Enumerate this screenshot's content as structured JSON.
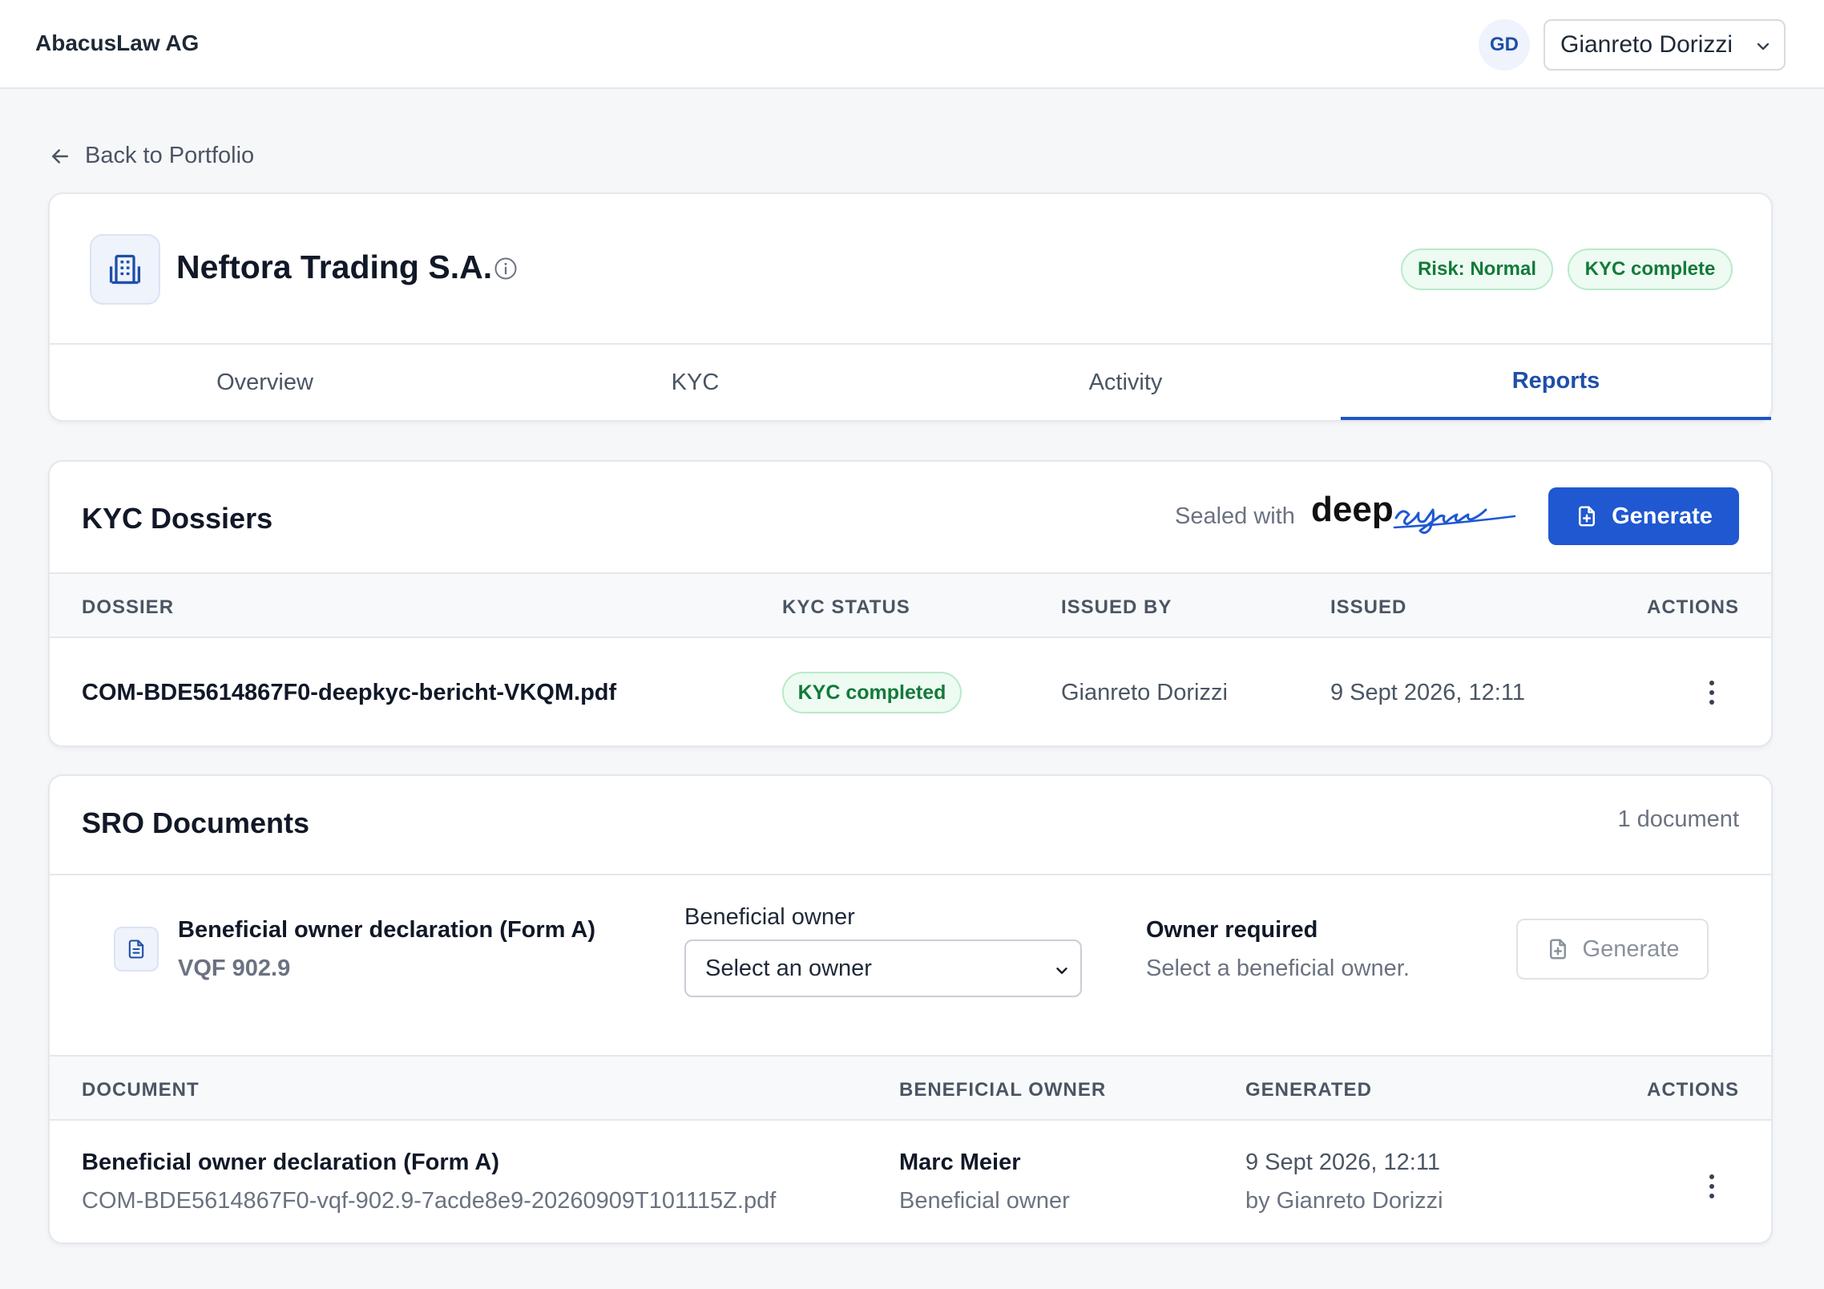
{
  "topbar": {
    "app_name": "AbacusLaw AG",
    "avatar_initials": "GD",
    "user_name": "Gianreto Dorizzi"
  },
  "back_link": "Back to Portfolio",
  "company": {
    "name": "Neftora Trading S.A.",
    "badges": [
      "Risk: Normal",
      "KYC complete"
    ]
  },
  "tabs": [
    {
      "label": "Overview",
      "active": false
    },
    {
      "label": "KYC",
      "active": false
    },
    {
      "label": "Activity",
      "active": false
    },
    {
      "label": "Reports",
      "active": true
    }
  ],
  "kyc_dossiers": {
    "title": "KYC Dossiers",
    "sealed_with": "Sealed with",
    "logo_text": "deepsign",
    "generate_label": "Generate",
    "columns": [
      "DOSSIER",
      "KYC STATUS",
      "ISSUED BY",
      "ISSUED",
      "ACTIONS"
    ],
    "rows": [
      {
        "dossier": "COM-BDE5614867F0-deepkyc-bericht-VKQM.pdf",
        "status": "KYC completed",
        "issued_by": "Gianreto Dorizzi",
        "issued": "9 Sept 2026, 12:11"
      }
    ]
  },
  "sro_documents": {
    "title": "SRO Documents",
    "count": "1 document",
    "template": {
      "title": "Beneficial owner declaration (Form A)",
      "code": "VQF 902.9",
      "field_label": "Beneficial owner",
      "select_placeholder": "Select an owner",
      "requirement_title": "Owner required",
      "requirement_sub": "Select a beneficial owner.",
      "generate_label": "Generate"
    },
    "columns": [
      "DOCUMENT",
      "BENEFICIAL OWNER",
      "GENERATED",
      "ACTIONS"
    ],
    "rows": [
      {
        "document": "Beneficial owner declaration (Form A)",
        "filename": "COM-BDE5614867F0-vqf-902.9-7acde8e9-20260909T101115Z.pdf",
        "owner": "Marc Meier",
        "owner_role": "Beneficial owner",
        "generated": "9 Sept 2026, 12:11",
        "generated_by": "by Gianreto Dorizzi"
      }
    ]
  },
  "colors": {
    "primary": "#1f58d1",
    "accent_text": "#1e4fa8",
    "success_text": "#137a3a",
    "success_bg": "#edfbf2"
  }
}
